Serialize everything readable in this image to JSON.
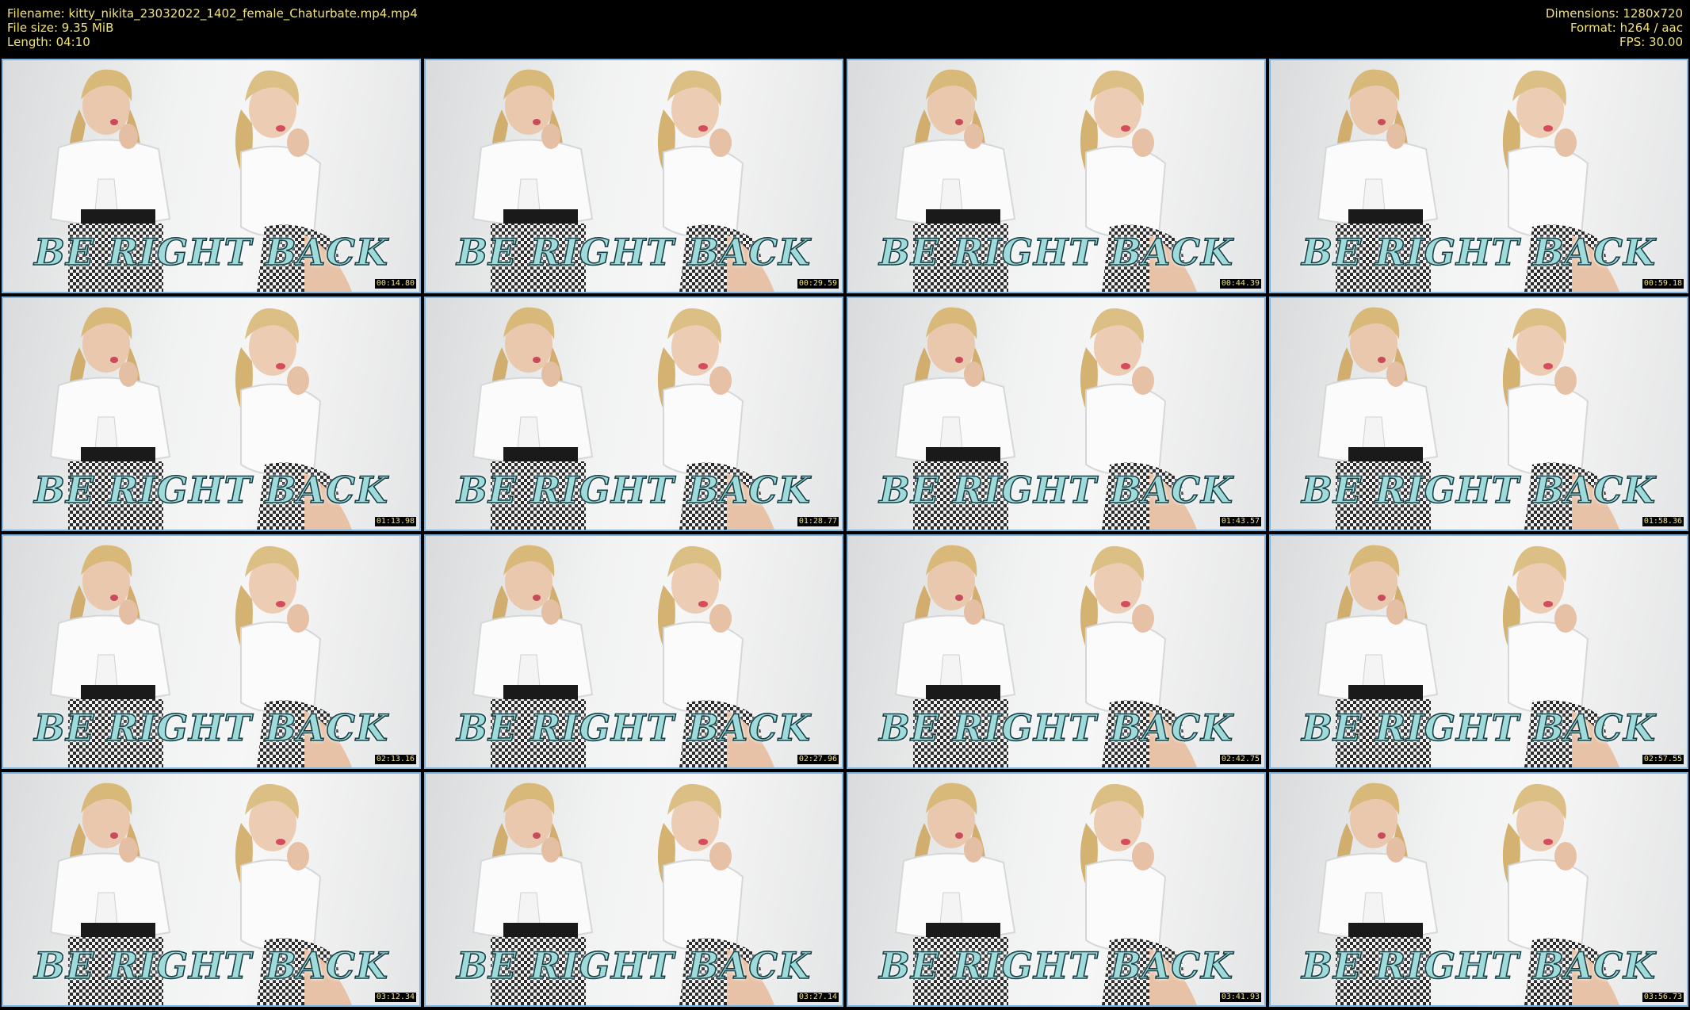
{
  "header": {
    "left": [
      {
        "label": "Filename:",
        "value": "kitty_nikita_23032022_1402_female_Chaturbate.mp4.mp4"
      },
      {
        "label": "File size:",
        "value": "9.35 MiB"
      },
      {
        "label": "Length:",
        "value": "04:10"
      }
    ],
    "right": [
      {
        "label": "Dimensions:",
        "value": "1280x720"
      },
      {
        "label": "Format:",
        "value": "h264 / aac"
      },
      {
        "label": "FPS:",
        "value": "30.00"
      }
    ]
  },
  "overlay_text": "BE RIGHT BACK",
  "colors": {
    "header_text": "#f2e27a",
    "thumb_border": "#7fb3df",
    "overlay_fill": "#9fdbdb",
    "overlay_stroke": "#173f45"
  },
  "thumbnails": [
    {
      "timestamp": "00:14.80"
    },
    {
      "timestamp": "00:29.59"
    },
    {
      "timestamp": "00:44.39"
    },
    {
      "timestamp": "00:59.18"
    },
    {
      "timestamp": "01:13.98"
    },
    {
      "timestamp": "01:28.77"
    },
    {
      "timestamp": "01:43.57"
    },
    {
      "timestamp": "01:58.36"
    },
    {
      "timestamp": "02:13.16"
    },
    {
      "timestamp": "02:27.96"
    },
    {
      "timestamp": "02:42.75"
    },
    {
      "timestamp": "02:57.55"
    },
    {
      "timestamp": "03:12.34"
    },
    {
      "timestamp": "03:27.14"
    },
    {
      "timestamp": "03:41.93"
    },
    {
      "timestamp": "03:56.73"
    }
  ]
}
